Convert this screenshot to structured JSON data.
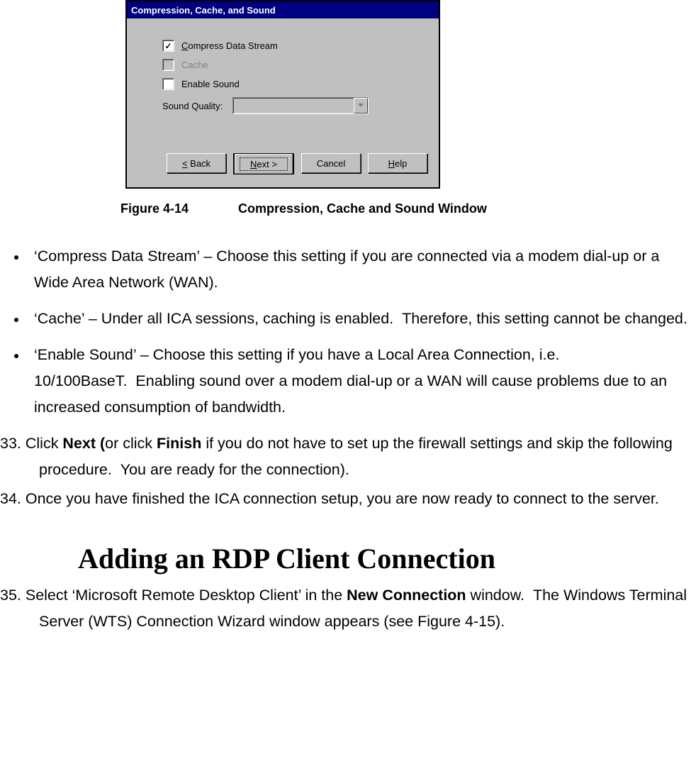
{
  "dialog": {
    "title": "Compression, Cache, and Sound",
    "compress_label": "Compress Data Stream",
    "cache_label": "Cache",
    "enable_sound_label": "Enable Sound",
    "sound_quality_label": "Sound Quality:",
    "buttons": {
      "back": "< Back",
      "next": "Next >",
      "cancel": "Cancel",
      "help": "Help"
    }
  },
  "caption": {
    "fig": "Figure 4-14",
    "title": "Compression, Cache and Sound Window"
  },
  "bullets": {
    "b1": "‘Compress Data Stream’ – Choose this setting if you are connected via a modem dial-up or a Wide Area Network (WAN).",
    "b2": "‘Cache’ – Under all ICA sessions, caching is enabled.  Therefore, this setting cannot be changed.",
    "b3": "‘Enable Sound’ – Choose this setting if you have a Local Area Connection, i.e. 10/100BaseT.  Enabling sound over a modem dial-up or a WAN will cause problems due to an increased consumption of bandwidth."
  },
  "steps": {
    "s33_pre": "33. Click ",
    "s33_next": "Next (",
    "s33_mid": "or click ",
    "s33_finish": "Finish",
    "s33_post": " if you do not have to set up the firewall settings and skip the following procedure.  You are ready for the connection).",
    "s34": "34. Once you have finished the ICA connection setup, you are now ready to connect to the server.",
    "s35_pre": "35. Select ‘Microsoft Remote Desktop Client’ in the ",
    "s35_bold": "New Connection",
    "s35_post": " window.  The Windows Terminal Server (WTS) Connection Wizard window appears (see Figure 4-15)."
  },
  "heading": "Adding an RDP Client Connection"
}
